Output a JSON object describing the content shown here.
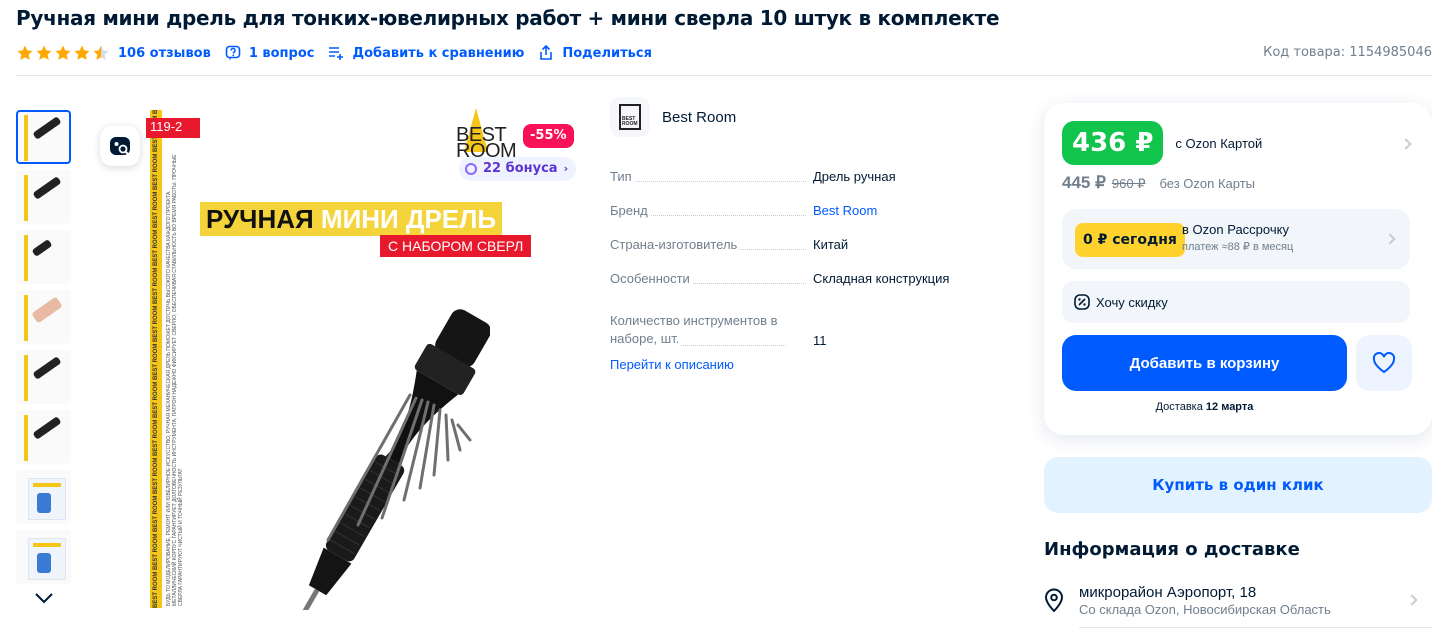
{
  "product": {
    "title": "Ручная мини дрель для тонких-ювелирных работ + мини сверла 10 штук в комплекте",
    "rating_stars": 4.5,
    "reviews_label": "106 отзывов",
    "questions_label": "1 вопрос",
    "compare_label": "Добавить к сравнению",
    "share_label": "Поделиться",
    "sku_label": "Код товара: 1154985046"
  },
  "gallery": {
    "thumbnails_count": 8,
    "price_tag": "119-2",
    "brand_line1": "BEST",
    "brand_line2": "ROOM",
    "discount": "-55%",
    "bonus": "22 бонуса",
    "headline_dark": "РУЧНАЯ ",
    "headline_light": "МИНИ ДРЕЛЬ",
    "subheadline": "С НАБОРОМ СВЕРЛ",
    "strip_text": "BEST ROOM BEST ROOM BEST ROOM BEST ROOM BEST ROOM BEST ROOM BEST ROOM BEST ROOM BEST ROOM BEST ROOM BEST ROOM BEST ROOM BEST ROOM BEST ROOM",
    "desc_text": "БУДЬ ТО МОДЕЛИРОВАНИЕ, РЕМОНТ ИЛИ ЮВЕЛИРНОЕ ИСКУССТВО, РУЧНАЯ МЕХАНИЧЕСКАЯ ДРЕЛЬ ПОМОЖЕТ ДОСТИЧЬ ВЫСОКОГО КАЧЕСТВА КАЖДОГО ПРОЕКТА. МЕТАЛЛИЧЕСКИЙ КОРПУС ГАРАНТИРУЕТ ДОЛГОВЕЧНОСТЬ ИНСТРУМЕНТА, ПАТРОН НАДЕЖНО ФИКСИРУЕТ СВЕРЛО, ОБЕСПЕЧИВАЯ СТАБИЛЬНОСТЬ ВО ВРЕМЯ РАБОТЫ. ПРОЧНЫЕ СВЕРЛА ГАРАНТИРУЮТ ЧИСТЫЙ И ТОЧНЫЙ РЕЗУЛЬТАТ"
  },
  "seller": {
    "name": "Best Room",
    "logo_text": "BEST ROOM"
  },
  "characteristics": [
    {
      "key": "Тип",
      "value": "Дрель ручная",
      "link": false
    },
    {
      "key": "Бренд",
      "value": "Best Room",
      "link": true
    },
    {
      "key": "Страна-изготовитель",
      "value": "Китай",
      "link": false
    },
    {
      "key": "Особенности",
      "value": "Складная конструкция",
      "link": false
    },
    {
      "key": "Количество инструментов в наборе, шт.",
      "value": "11",
      "link": false
    }
  ],
  "to_description": "Перейти к описанию",
  "price_card": {
    "card_price": "436 ₽",
    "card_label": "с Ozon Картой",
    "price": "445 ₽",
    "old_price": "960 ₽",
    "no_card_label": "без Ozon Карты",
    "installment_badge": "0 ₽ сегодня",
    "installment_title": "в Ozon Рассрочку",
    "installment_sub": "платеж ≈88 ₽ в месяц",
    "want_discount": "Хочу скидку",
    "add_to_cart": "Добавить в корзину",
    "delivery_prefix": "Доставка ",
    "delivery_date": "12 марта"
  },
  "one_click": "Купить в один клик",
  "delivery_info": {
    "title": "Информация о доставке",
    "address": "микрорайон Аэропорт, 18",
    "warehouse": "Со склада Ozon, Новосибирская Область"
  },
  "colors": {
    "accent": "#005bff",
    "green": "#10c44c",
    "star": "#ffa800",
    "discount": "#f91155",
    "yellow": "#ffd22d"
  }
}
